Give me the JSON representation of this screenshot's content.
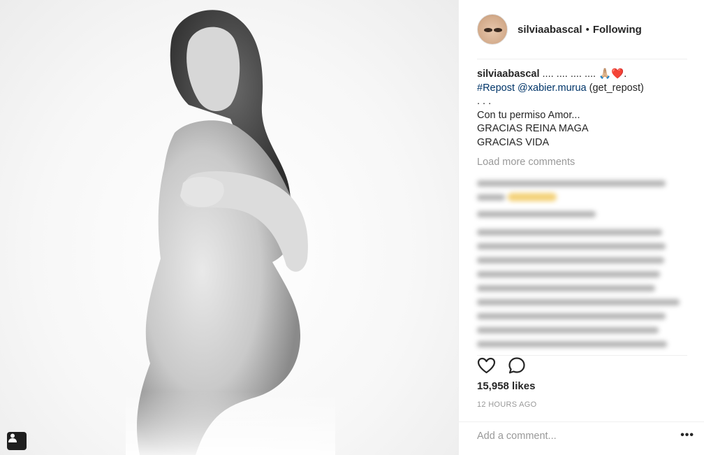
{
  "post": {
    "username": "silviaabascal",
    "separator": "•",
    "follow_status": "Following",
    "caption": {
      "username": "silviaabascal",
      "first_line_text": ".... .... .... ....",
      "first_line_emoji": "🙏🏼❤️.",
      "hashtag": "#Repost",
      "mention": "@xabier.murua",
      "after_mention": " (get_repost)",
      "dots": ". . .",
      "line1": "Con tu permiso Amor...",
      "line2": "GRACIAS REINA MAGA",
      "line3": "GRACIAS VIDA"
    },
    "load_more": "Load more comments",
    "likes": "15,958 likes",
    "timestamp": "12 HOURS AGO",
    "comment_placeholder": "Add a comment...",
    "more_label": "•••"
  },
  "icons": {
    "like": "heart-icon",
    "comment": "speech-bubble-icon",
    "tag": "user-tag-icon",
    "more": "ellipsis-icon"
  },
  "colors": {
    "link": "#003569",
    "muted": "#999999",
    "text": "#262626"
  }
}
